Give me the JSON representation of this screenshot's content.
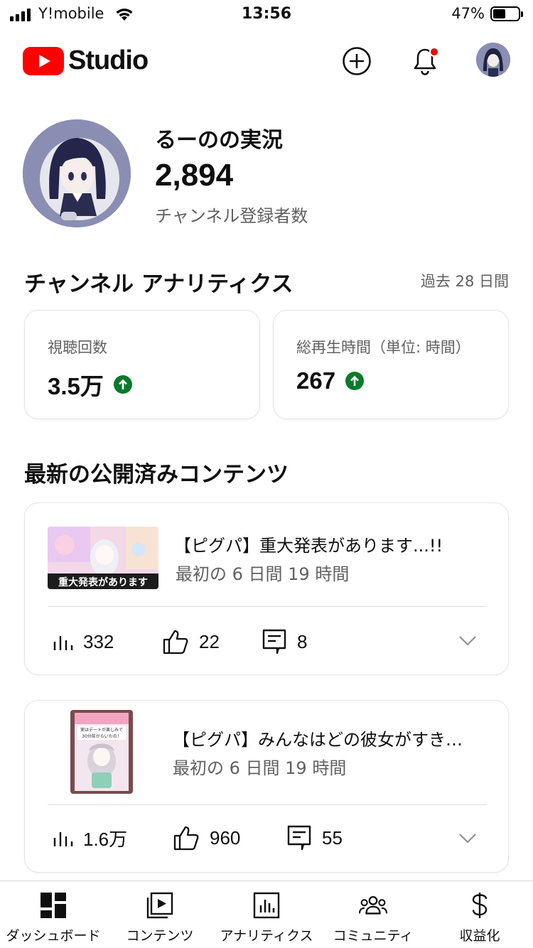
{
  "status_bar": {
    "carrier": "Y!mobile",
    "time": "13:56",
    "battery": "47%"
  },
  "header": {
    "logo_text": "Studio",
    "icons": [
      "youtube-logo-icon",
      "create-plus-icon",
      "bell-icon",
      "avatar"
    ],
    "accent_color": "#ff0000",
    "notification_dot_color": "#ee0000"
  },
  "channel": {
    "name": "るーのの実況",
    "subscriber_count": "2,894",
    "subscriber_label": "チャンネル登録者数"
  },
  "analytics": {
    "title": "チャンネル アナリティクス",
    "period": "過去 28 日間",
    "cards": [
      {
        "label": "視聴回数",
        "value": "3.5万",
        "trend": "up"
      },
      {
        "label": "総再生時間（単位: 時間）",
        "value": "267",
        "trend": "up"
      }
    ],
    "trend_color": "#0b7a2b"
  },
  "latest": {
    "title": "最新の公開済みコンテンツ",
    "videos": [
      {
        "title": "【ピグパ】重大発表があります...!!",
        "subtitle": "最初の 6 日間 19 時間",
        "thumbnail_text": "重大発表があります",
        "views": "332",
        "likes": "22",
        "comments": "8"
      },
      {
        "title": "【ピグパ】みんなはどの彼女がすき…",
        "subtitle": "最初の 6 日間 19 時間",
        "thumbnail_text": "実はデートが楽しみで30分前からいたの！",
        "views": "1.6万",
        "likes": "960",
        "comments": "55"
      }
    ]
  },
  "bottom_nav": [
    {
      "label": "ダッシュボード",
      "icon": "dashboard-icon"
    },
    {
      "label": "コンテンツ",
      "icon": "content-icon"
    },
    {
      "label": "アナリティクス",
      "icon": "analytics-icon"
    },
    {
      "label": "コミュニティ",
      "icon": "community-icon"
    },
    {
      "label": "収益化",
      "icon": "dollar-icon"
    }
  ]
}
